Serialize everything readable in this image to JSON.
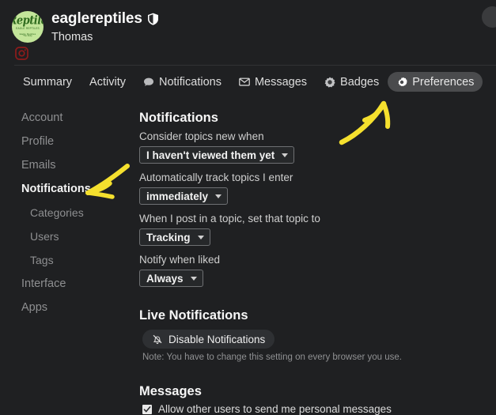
{
  "theme": {
    "page_bg": "#1f2022",
    "text_primary": "#f5f5f5",
    "text_muted": "#8e8f91",
    "active_tab_bg": "#4a4b4d",
    "annotation_color": "#f5e02e",
    "avatar_bg": "#c3e59a",
    "avatar_logo_color": "#2f6b1e",
    "instagram_icon_color": "#8e1b1b"
  },
  "profile": {
    "username": "eaglereptiles",
    "shield_icon": "shield-icon",
    "full_name": "Thomas",
    "avatar": {
      "icon_name": "user-avatar",
      "logo_main": "Reptile",
      "logo_sub1": "EAGLE REPTILES",
      "logo_sub2": "Eagle Reptiles",
      "logo_sub3": "The Shop"
    },
    "social_links": [
      {
        "icon_name": "instagram-icon",
        "label": "Instagram"
      }
    ],
    "top_right_avatar": "current-user-avatar"
  },
  "nav_tabs": [
    {
      "label": "Summary",
      "icon": null,
      "active": false
    },
    {
      "label": "Activity",
      "icon": null,
      "active": false
    },
    {
      "label": "Notifications",
      "icon": "speech-bubble-icon",
      "active": false
    },
    {
      "label": "Messages",
      "icon": "envelope-icon",
      "active": false
    },
    {
      "label": "Badges",
      "icon": "badge-icon",
      "active": false
    },
    {
      "label": "Preferences",
      "icon": "gear-icon",
      "active": true
    }
  ],
  "settings_nav": [
    {
      "label": "Account",
      "active": false,
      "sub": false
    },
    {
      "label": "Profile",
      "active": false,
      "sub": false
    },
    {
      "label": "Emails",
      "active": false,
      "sub": false
    },
    {
      "label": "Notifications",
      "active": true,
      "sub": false
    },
    {
      "label": "Categories",
      "active": false,
      "sub": true
    },
    {
      "label": "Users",
      "active": false,
      "sub": true
    },
    {
      "label": "Tags",
      "active": false,
      "sub": true
    },
    {
      "label": "Interface",
      "active": false,
      "sub": false
    },
    {
      "label": "Apps",
      "active": false,
      "sub": false
    }
  ],
  "main": {
    "notifications": {
      "title": "Notifications",
      "fields": [
        {
          "label": "Consider topics new when",
          "value": "I haven't viewed them yet"
        },
        {
          "label": "Automatically track topics I enter",
          "value": "immediately"
        },
        {
          "label": "When I post in a topic, set that topic to",
          "value": "Tracking"
        },
        {
          "label": "Notify when liked",
          "value": "Always"
        }
      ]
    },
    "live_notifications": {
      "title": "Live Notifications",
      "button_label": "Disable Notifications",
      "button_icon": "bell-slash-icon",
      "note": "Note: You have to change this setting on every browser you use."
    },
    "messages": {
      "title": "Messages",
      "checkbox_label": "Allow other users to send me personal messages",
      "checkbox_checked": true
    }
  },
  "annotations": [
    {
      "name": "arrow-to-preferences",
      "target": "Preferences tab",
      "color": "#f5e02e"
    },
    {
      "name": "arrow-to-notifications",
      "target": "Notifications sidebar item",
      "color": "#f5e02e"
    }
  ]
}
